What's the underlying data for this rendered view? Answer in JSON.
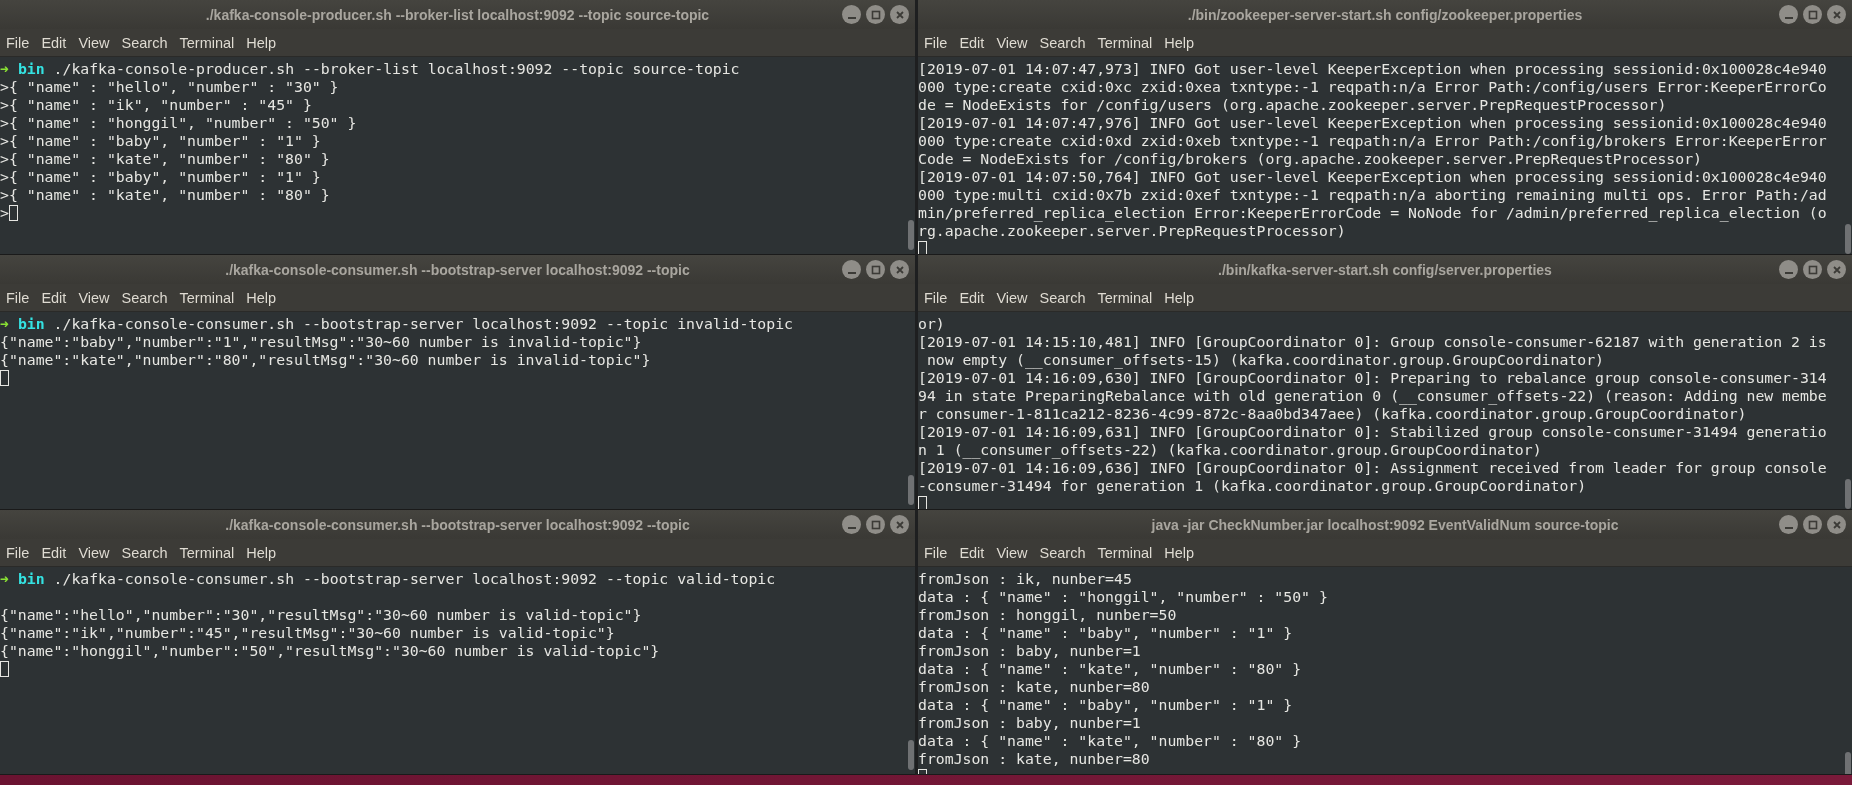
{
  "windows": [
    {
      "title": "./kafka-console-producer.sh --broker-list localhost:9092 --topic source-topic",
      "menu": [
        "File",
        "Edit",
        "View",
        "Search",
        "Terminal",
        "Help"
      ],
      "lines": [
        {
          "kind": "prompt",
          "arrow": "➜",
          "dir": "bin",
          "text": " ./kafka-console-producer.sh --broker-list localhost:9092 --topic source-topic"
        },
        {
          "kind": "text",
          "text": ">{ \"name\" : \"hello\", \"number\" : \"30\" }"
        },
        {
          "kind": "text",
          "text": ">{ \"name\" : \"ik\", \"number\" : \"45\" }"
        },
        {
          "kind": "text",
          "text": ">{ \"name\" : \"honggil\", \"number\" : \"50\" }"
        },
        {
          "kind": "text",
          "text": ">{ \"name\" : \"baby\", \"number\" : \"1\" }"
        },
        {
          "kind": "text",
          "text": ">{ \"name\" : \"kate\", \"number\" : \"80\" }"
        },
        {
          "kind": "text",
          "text": ">{ \"name\" : \"baby\", \"number\" : \"1\" }"
        },
        {
          "kind": "text",
          "text": ">{ \"name\" : \"kate\", \"number\" : \"80\" }"
        },
        {
          "kind": "cursor",
          "text": ">"
        }
      ]
    },
    {
      "title": "./bin/zookeeper-server-start.sh config/zookeeper.properties",
      "menu": [
        "File",
        "Edit",
        "View",
        "Search",
        "Terminal",
        "Help"
      ],
      "lines": [
        {
          "kind": "text",
          "text": "[2019-07-01 14:07:47,973] INFO Got user-level KeeperException when processing sessionid:0x100028c4e940"
        },
        {
          "kind": "text",
          "text": "000 type:create cxid:0xc zxid:0xea txntype:-1 reqpath:n/a Error Path:/config/users Error:KeeperErrorCo"
        },
        {
          "kind": "text",
          "text": "de = NodeExists for /config/users (org.apache.zookeeper.server.PrepRequestProcessor)"
        },
        {
          "kind": "text",
          "text": "[2019-07-01 14:07:47,976] INFO Got user-level KeeperException when processing sessionid:0x100028c4e940"
        },
        {
          "kind": "text",
          "text": "000 type:create cxid:0xd zxid:0xeb txntype:-1 reqpath:n/a Error Path:/config/brokers Error:KeeperError"
        },
        {
          "kind": "text",
          "text": "Code = NodeExists for /config/brokers (org.apache.zookeeper.server.PrepRequestProcessor)"
        },
        {
          "kind": "text",
          "text": "[2019-07-01 14:07:50,764] INFO Got user-level KeeperException when processing sessionid:0x100028c4e940"
        },
        {
          "kind": "text",
          "text": "000 type:multi cxid:0x7b zxid:0xef txntype:-1 reqpath:n/a aborting remaining multi ops. Error Path:/ad"
        },
        {
          "kind": "text",
          "text": "min/preferred_replica_election Error:KeeperErrorCode = NoNode for /admin/preferred_replica_election (o"
        },
        {
          "kind": "text",
          "text": "rg.apache.zookeeper.server.PrepRequestProcessor)"
        },
        {
          "kind": "cursor"
        }
      ]
    },
    {
      "title": "./kafka-console-consumer.sh --bootstrap-server localhost:9092 --topic",
      "menu": [
        "File",
        "Edit",
        "View",
        "Search",
        "Terminal",
        "Help"
      ],
      "lines": [
        {
          "kind": "prompt",
          "arrow": "➜",
          "dir": "bin",
          "text": " ./kafka-console-consumer.sh --bootstrap-server localhost:9092 --topic invalid-topic"
        },
        {
          "kind": "text",
          "text": "{\"name\":\"baby\",\"number\":\"1\",\"resultMsg\":\"30~60 number is invalid-topic\"}"
        },
        {
          "kind": "text",
          "text": "{\"name\":\"kate\",\"number\":\"80\",\"resultMsg\":\"30~60 number is invalid-topic\"}"
        },
        {
          "kind": "cursor"
        }
      ]
    },
    {
      "title": "./bin/kafka-server-start.sh config/server.properties",
      "menu": [
        "File",
        "Edit",
        "View",
        "Search",
        "Terminal",
        "Help"
      ],
      "lines": [
        {
          "kind": "text",
          "text": "or)"
        },
        {
          "kind": "text",
          "text": "[2019-07-01 14:15:10,481] INFO [GroupCoordinator 0]: Group console-consumer-62187 with generation 2 is"
        },
        {
          "kind": "text",
          "text": " now empty (__consumer_offsets-15) (kafka.coordinator.group.GroupCoordinator)"
        },
        {
          "kind": "text",
          "text": "[2019-07-01 14:16:09,630] INFO [GroupCoordinator 0]: Preparing to rebalance group console-consumer-314"
        },
        {
          "kind": "text",
          "text": "94 in state PreparingRebalance with old generation 0 (__consumer_offsets-22) (reason: Adding new membe"
        },
        {
          "kind": "text",
          "text": "r consumer-1-811ca212-8236-4c99-872c-8aa0bd347aee) (kafka.coordinator.group.GroupCoordinator)"
        },
        {
          "kind": "text",
          "text": "[2019-07-01 14:16:09,631] INFO [GroupCoordinator 0]: Stabilized group console-consumer-31494 generatio"
        },
        {
          "kind": "text",
          "text": "n 1 (__consumer_offsets-22) (kafka.coordinator.group.GroupCoordinator)"
        },
        {
          "kind": "text",
          "text": "[2019-07-01 14:16:09,636] INFO [GroupCoordinator 0]: Assignment received from leader for group console"
        },
        {
          "kind": "text",
          "text": "-consumer-31494 for generation 1 (kafka.coordinator.group.GroupCoordinator)"
        },
        {
          "kind": "cursor"
        }
      ]
    },
    {
      "title": "./kafka-console-consumer.sh --bootstrap-server localhost:9092 --topic",
      "menu": [
        "File",
        "Edit",
        "View",
        "Search",
        "Terminal",
        "Help"
      ],
      "lines": [
        {
          "kind": "prompt",
          "arrow": "➜",
          "dir": "bin",
          "text": " ./kafka-console-consumer.sh --bootstrap-server localhost:9092 --topic valid-topic"
        },
        {
          "kind": "blank"
        },
        {
          "kind": "text",
          "text": "{\"name\":\"hello\",\"number\":\"30\",\"resultMsg\":\"30~60 number is valid-topic\"}"
        },
        {
          "kind": "text",
          "text": "{\"name\":\"ik\",\"number\":\"45\",\"resultMsg\":\"30~60 number is valid-topic\"}"
        },
        {
          "kind": "text",
          "text": "{\"name\":\"honggil\",\"number\":\"50\",\"resultMsg\":\"30~60 number is valid-topic\"}"
        },
        {
          "kind": "cursor"
        }
      ]
    },
    {
      "title": "java -jar CheckNumber.jar localhost:9092 EventValidNum source-topic",
      "menu": [
        "File",
        "Edit",
        "View",
        "Search",
        "Terminal",
        "Help"
      ],
      "lines": [
        {
          "kind": "text",
          "text": "fromJson : ik, nunber=45"
        },
        {
          "kind": "text",
          "text": "data : { \"name\" : \"honggil\", \"number\" : \"50\" }"
        },
        {
          "kind": "text",
          "text": "fromJson : honggil, nunber=50"
        },
        {
          "kind": "text",
          "text": "data : { \"name\" : \"baby\", \"number\" : \"1\" }"
        },
        {
          "kind": "text",
          "text": "fromJson : baby, nunber=1"
        },
        {
          "kind": "text",
          "text": "data : { \"name\" : \"kate\", \"number\" : \"80\" }"
        },
        {
          "kind": "text",
          "text": "fromJson : kate, nunber=80"
        },
        {
          "kind": "text",
          "text": "data : { \"name\" : \"baby\", \"number\" : \"1\" }"
        },
        {
          "kind": "text",
          "text": "fromJson : baby, nunber=1"
        },
        {
          "kind": "text",
          "text": "data : { \"name\" : \"kate\", \"number\" : \"80\" }"
        },
        {
          "kind": "text",
          "text": "fromJson : kate, nunber=80"
        },
        {
          "kind": "cursor"
        }
      ]
    }
  ]
}
